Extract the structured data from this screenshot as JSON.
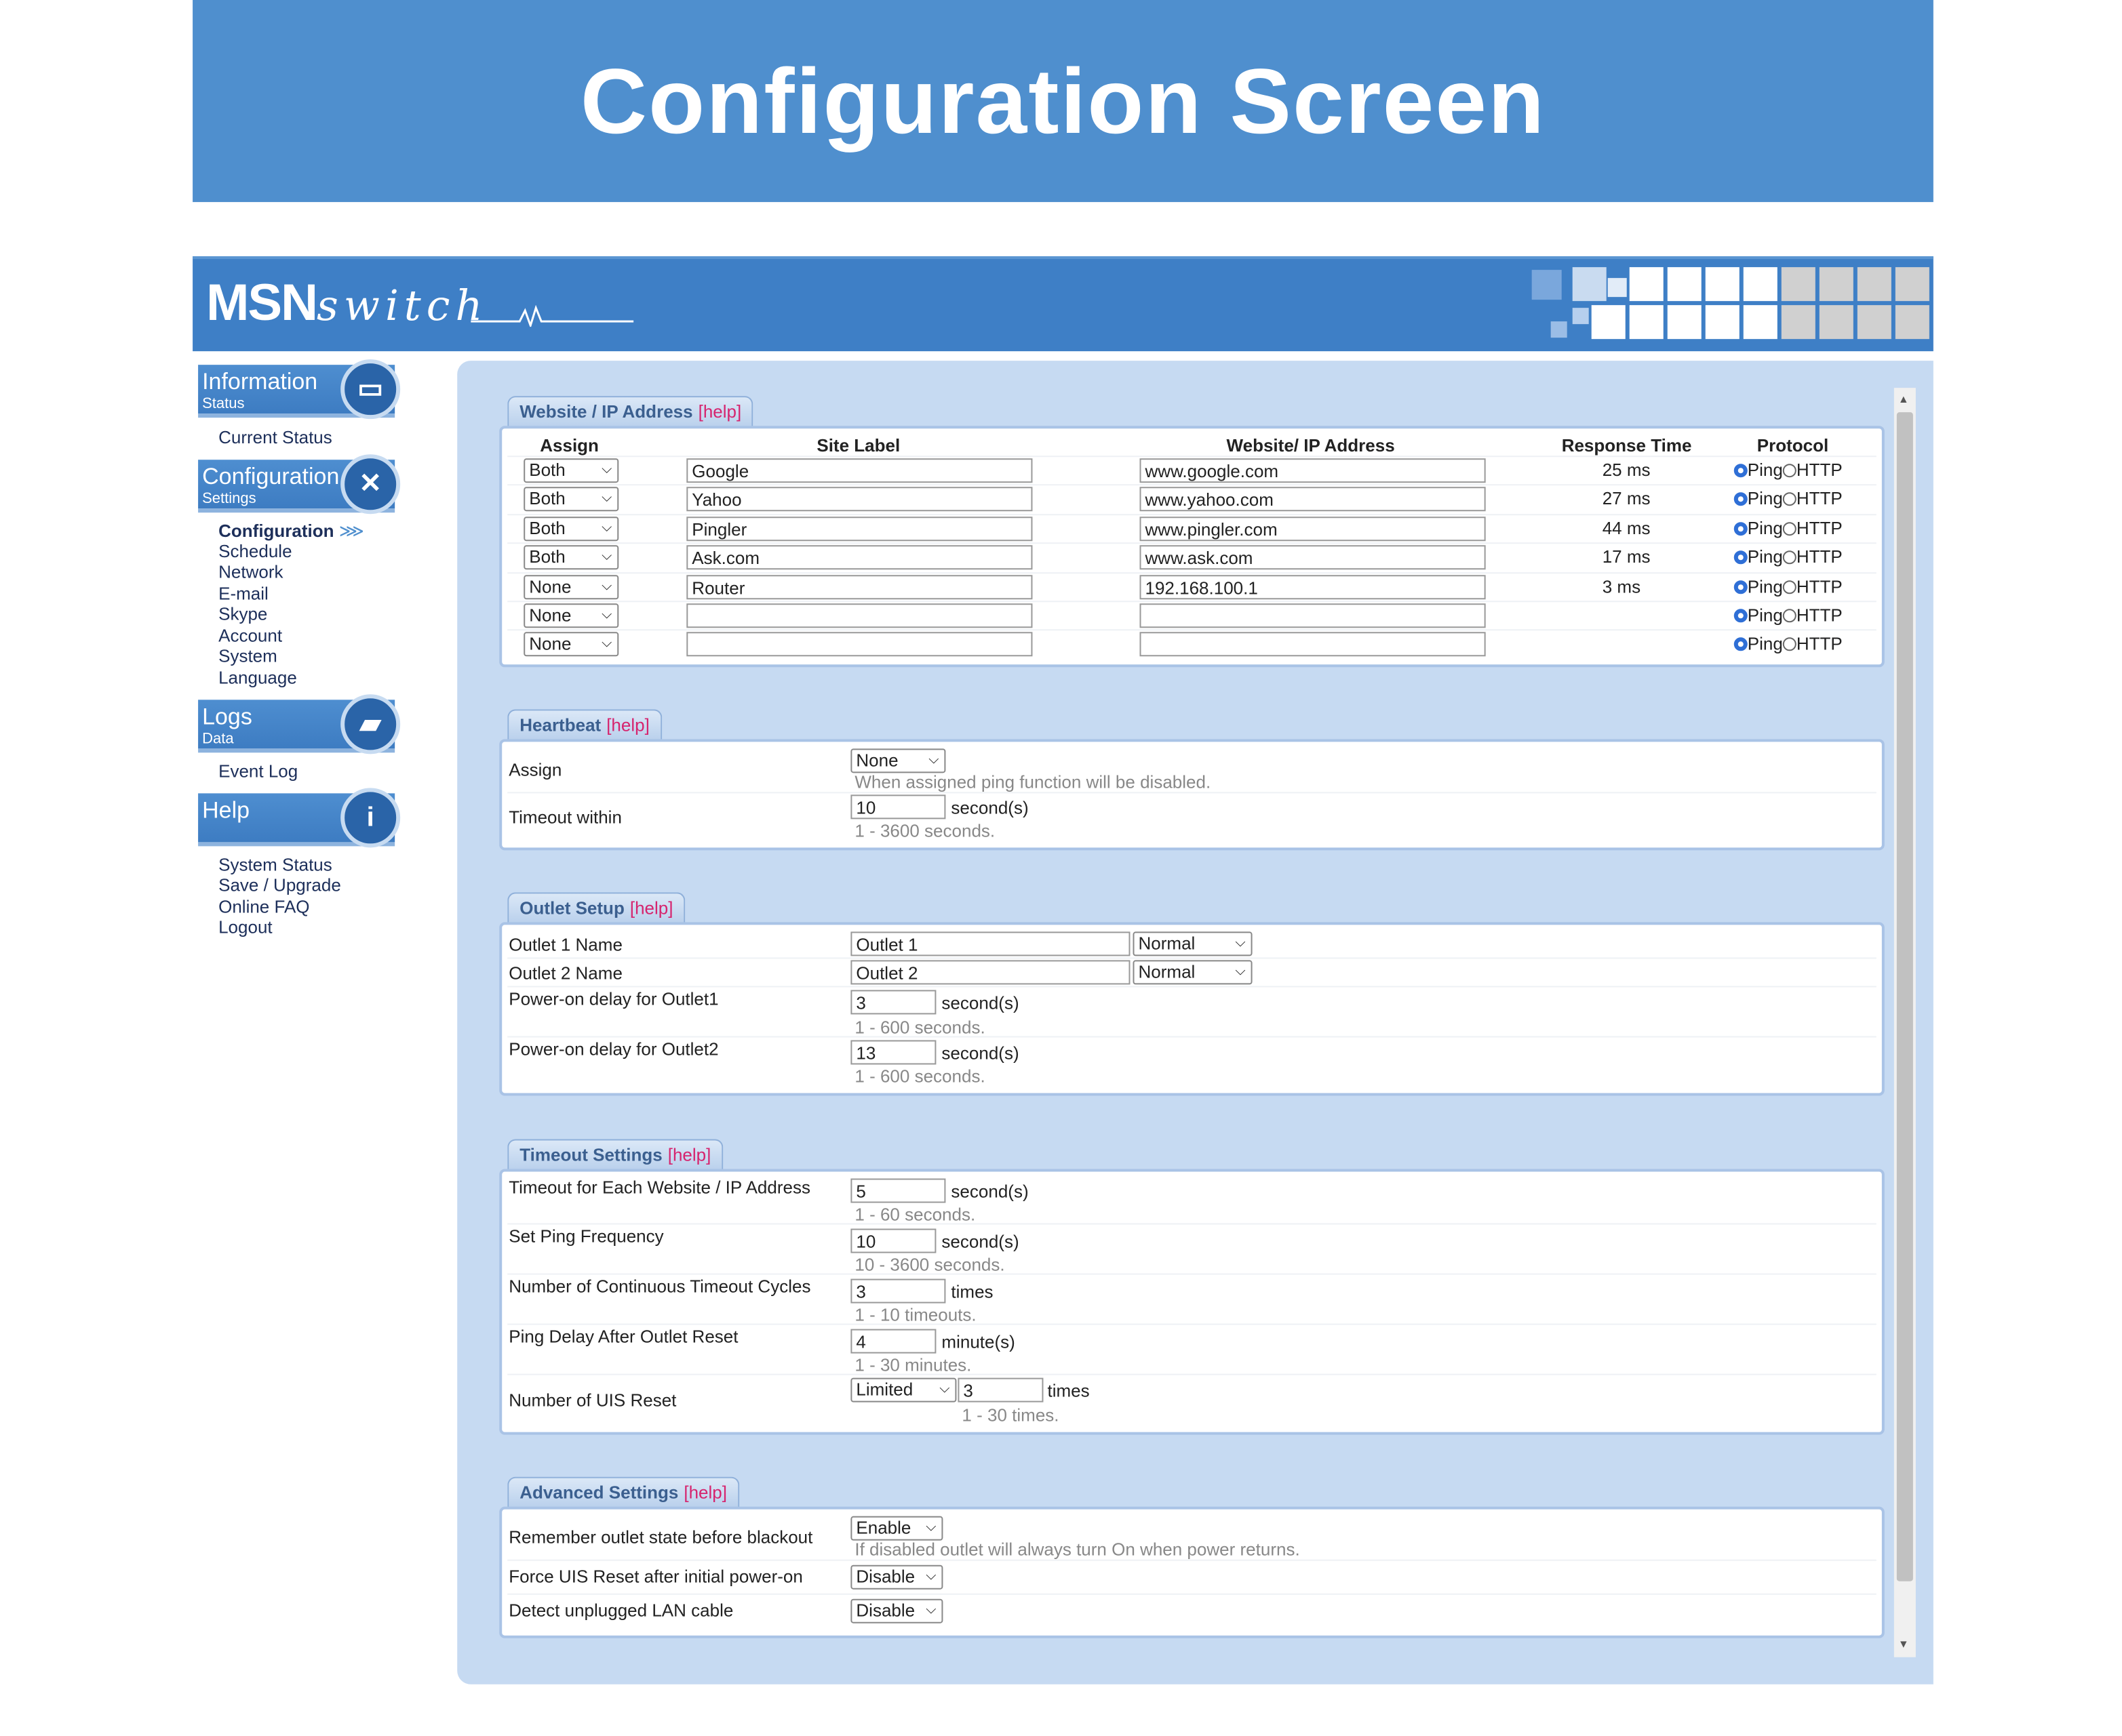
{
  "banner": {
    "title": "Configuration Screen"
  },
  "header": {
    "logo_bold": "MSN",
    "logo_italic": "switch"
  },
  "sidebar": {
    "sections": [
      {
        "title": "Information",
        "subtitle": "Status",
        "icon": "monitor-icon",
        "links": [
          "Current Status"
        ]
      },
      {
        "title": "Configuration",
        "subtitle": "Settings",
        "icon": "tools-icon",
        "links": [
          "Configuration",
          "Schedule",
          "Network",
          "E-mail",
          "Skype",
          "Account",
          "System",
          "Language"
        ]
      },
      {
        "title": "Logs",
        "subtitle": "Data",
        "icon": "folder-icon",
        "links": [
          "Event Log"
        ]
      },
      {
        "title": "Help",
        "subtitle": "",
        "icon": "info-icon",
        "links": [
          "System Status",
          "Save / Upgrade",
          "Online FAQ",
          "Logout"
        ]
      }
    ],
    "active_link": "Configuration",
    "active_marker": "⋙"
  },
  "website_section": {
    "tab": "Website / IP Address",
    "help": "[help]",
    "columns": [
      "Assign",
      "Site Label",
      "Website/ IP Address",
      "Response Time",
      "Protocol"
    ],
    "rows": [
      {
        "assign": "Both",
        "label": "Google",
        "address": "www.google.com",
        "response": "25 ms",
        "protocol": "Ping"
      },
      {
        "assign": "Both",
        "label": "Yahoo",
        "address": "www.yahoo.com",
        "response": "27 ms",
        "protocol": "Ping"
      },
      {
        "assign": "Both",
        "label": "Pingler",
        "address": "www.pingler.com",
        "response": "44 ms",
        "protocol": "Ping"
      },
      {
        "assign": "Both",
        "label": "Ask.com",
        "address": "www.ask.com",
        "response": "17 ms",
        "protocol": "Ping"
      },
      {
        "assign": "None",
        "label": "Router",
        "address": "192.168.100.1",
        "response": "3 ms",
        "protocol": "Ping"
      },
      {
        "assign": "None",
        "label": "",
        "address": "",
        "response": "",
        "protocol": "Ping"
      },
      {
        "assign": "None",
        "label": "",
        "address": "",
        "response": "",
        "protocol": "Ping"
      }
    ],
    "protocol_options": [
      "Ping",
      "HTTP"
    ]
  },
  "heartbeat": {
    "tab": "Heartbeat",
    "help": "[help]",
    "assign_label": "Assign",
    "assign_value": "None",
    "assign_hint": "When assigned ping function will be disabled.",
    "timeout_label": "Timeout within",
    "timeout_value": "10",
    "timeout_unit": "second(s)",
    "timeout_hint": "1 - 3600 seconds."
  },
  "outlet_setup": {
    "tab": "Outlet Setup",
    "help": "[help]",
    "outlet1_label": "Outlet 1 Name",
    "outlet1_name": "Outlet 1",
    "outlet1_mode": "Normal",
    "outlet2_label": "Outlet 2 Name",
    "outlet2_name": "Outlet 2",
    "outlet2_mode": "Normal",
    "delay1_label": "Power-on delay for Outlet1",
    "delay1_value": "3",
    "delay2_label": "Power-on delay for Outlet2",
    "delay2_value": "13",
    "delay_unit": "second(s)",
    "delay_hint": "1 - 600 seconds."
  },
  "timeout_settings": {
    "tab": "Timeout Settings",
    "help": "[help]",
    "rows": [
      {
        "label": "Timeout for Each Website / IP Address",
        "value": "5",
        "unit": "second(s)",
        "hint": "1 - 60 seconds."
      },
      {
        "label": "Set Ping Frequency",
        "value": "10",
        "unit": "second(s)",
        "hint": "10 - 3600 seconds."
      },
      {
        "label": "Number of Continuous Timeout Cycles",
        "value": "3",
        "unit": "times",
        "hint": "1 - 10 timeouts."
      },
      {
        "label": "Ping Delay After Outlet Reset",
        "value": "4",
        "unit": "minute(s)",
        "hint": "1 - 30 minutes."
      }
    ],
    "uis_label": "Number of UIS Reset",
    "uis_mode": "Limited",
    "uis_value": "3",
    "uis_unit": "times",
    "uis_hint": "1 - 30 times."
  },
  "advanced": {
    "tab": "Advanced Settings",
    "help": "[help]",
    "remember_label": "Remember outlet state before blackout",
    "remember_value": "Enable",
    "remember_hint": "If disabled outlet will always turn On when power returns.",
    "force_label": "Force UIS Reset after initial power-on",
    "force_value": "Disable",
    "detect_label": "Detect unplugged LAN cable",
    "detect_value": "Disable"
  },
  "colors": {
    "banner": "#4f8fce",
    "header": "#3e7fc6",
    "panel": "#c6daf2",
    "help_link": "#d6246e",
    "radio_selected": "#2f6fd6"
  }
}
